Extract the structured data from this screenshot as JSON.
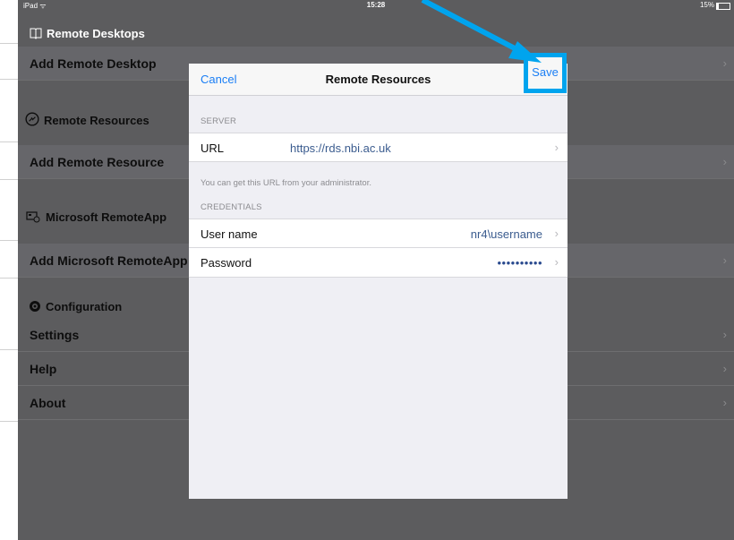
{
  "status_bar": {
    "carrier": "iPad ᯤ",
    "time": "15:28",
    "battery": "15%"
  },
  "sidebar": {
    "sections": [
      {
        "header": "Remote Desktops",
        "icon": "book-icon",
        "item": "Add Remote Desktop"
      },
      {
        "header": "Remote Resources",
        "icon": "remote-resources-icon",
        "item": "Add Remote Resource"
      },
      {
        "header": "Microsoft RemoteApp",
        "icon": "remoteapp-icon",
        "item": "Add Microsoft RemoteApp"
      },
      {
        "header": "Configuration",
        "icon": "gear-icon",
        "items": [
          "Settings",
          "Help",
          "About"
        ]
      }
    ],
    "chevron": "›"
  },
  "modal": {
    "cancel_label": "Cancel",
    "title": "Remote Resources",
    "save_label": "Save",
    "server_header": "SERVER",
    "url_label": "URL",
    "url_value": "https://rds.nbi.ac.uk",
    "url_hint": "You can get this URL from your administrator.",
    "credentials_header": "CREDENTIALS",
    "username_label": "User name",
    "username_value": "nr4\\username",
    "password_label": "Password",
    "password_value": "••••••••••",
    "chevron": "›"
  },
  "annotation": {
    "highlight_color": "#00a4ee"
  }
}
